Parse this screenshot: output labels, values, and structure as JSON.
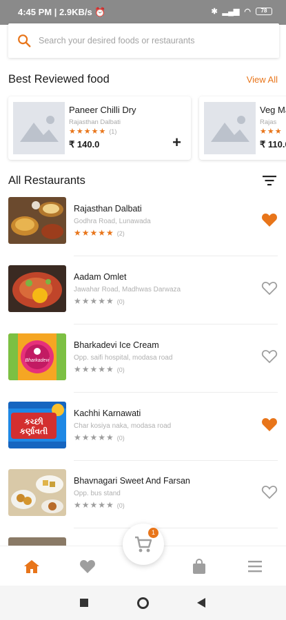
{
  "status_bar": {
    "time": "4:45 PM",
    "speed": "2.9KB/s",
    "battery": "78"
  },
  "search": {
    "placeholder": "Search your desired foods or restaurants"
  },
  "best_reviewed": {
    "title": "Best Reviewed food",
    "view_all": "View All",
    "items": [
      {
        "name": "Paneer Chilli Dry",
        "restaurant": "Rajasthan Dalbati",
        "stars": "★★★★★",
        "count": "(1)",
        "price": "₹ 140.0",
        "add": "+"
      },
      {
        "name": "Veg Ma",
        "restaurant": "Rajas",
        "stars": "★★★",
        "count": "",
        "price": "₹ 110.0",
        "add": ""
      }
    ]
  },
  "all_restaurants": {
    "title": "All Restaurants",
    "items": [
      {
        "name": "Rajasthan Dalbati",
        "address": "Godhra Road, Lunawada",
        "stars": "★★★★★",
        "count": "(2)",
        "favorite": true
      },
      {
        "name": "Aadam Omlet",
        "address": "Jawahar Road, Madhwas Darwaza",
        "stars": "★★★★★",
        "count": "(0)",
        "favorite": false
      },
      {
        "name": "Bharkadevi Ice Cream",
        "address": "Opp. saifi hospital, modasa road",
        "stars": "★★★★★",
        "count": "(0)",
        "favorite": false,
        "logo_text": "Bharkadevi"
      },
      {
        "name": "Kachhi Karnawati",
        "address": "Char kosiya naka, modasa road",
        "stars": "★★★★★",
        "count": "(0)",
        "favorite": true,
        "logo_text": "કચ્છી કર્ણાવતી"
      },
      {
        "name": "Bhavnagari Sweet And Farsan",
        "address": "Opp. bus stand",
        "stars": "★★★★★",
        "count": "(0)",
        "favorite": false
      }
    ]
  },
  "cart": {
    "badge": "1"
  },
  "bottom_nav": [
    "home-icon",
    "heart-icon",
    "bag-icon",
    "menu-icon"
  ],
  "colors": {
    "accent": "#e8751a",
    "star_empty": "#9e9e9e"
  }
}
